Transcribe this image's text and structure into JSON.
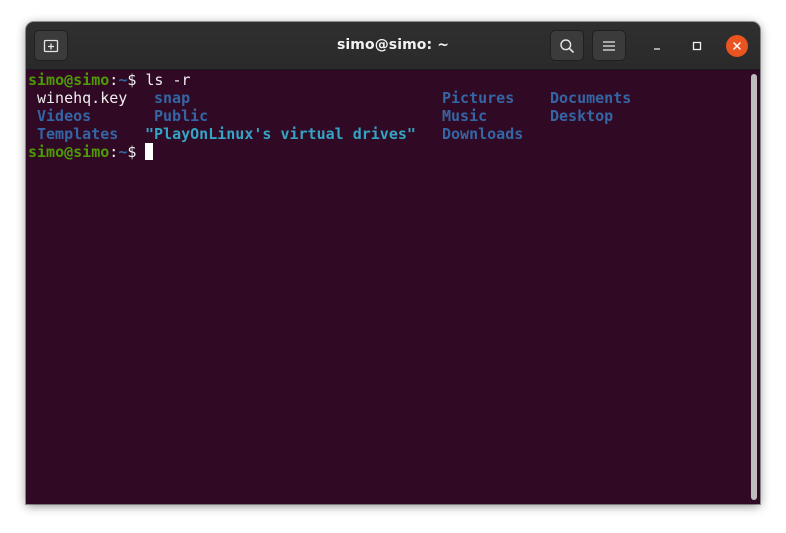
{
  "window": {
    "title": "simo@simo: ~"
  },
  "titlebar": {
    "new_tab_icon": "new-tab-icon",
    "search_icon": "search-icon",
    "menu_icon": "hamburger-menu-icon",
    "minimize_icon": "minimize-icon",
    "maximize_icon": "maximize-icon",
    "close_icon": "close-icon",
    "close_color": "#e95420"
  },
  "terminal": {
    "background": "#300a24",
    "prompt": {
      "user_host": "simo@simo",
      "separator": ":",
      "path": "~",
      "symbol": "$"
    },
    "command": "ls -r",
    "ls_output": {
      "row1": [
        "winehq.key",
        "snap",
        "Pictures",
        "Documents"
      ],
      "row2": [
        "Videos",
        "Public",
        "Music",
        "Desktop"
      ],
      "row3": [
        "Templates",
        "\"PlayOnLinux's virtual drives\"",
        "Downloads"
      ]
    }
  }
}
